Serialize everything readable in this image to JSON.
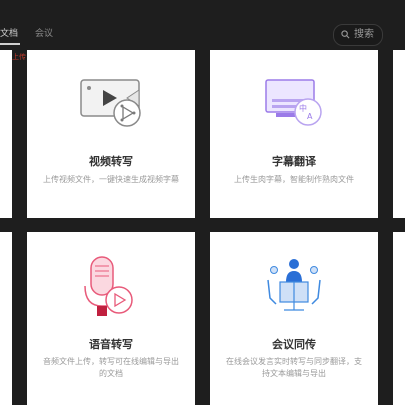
{
  "header": {
    "tabs": [
      {
        "label": "文档",
        "active": true
      },
      {
        "label": "会议",
        "active": false
      }
    ],
    "red_mark": "上传",
    "search_label": "搜索"
  },
  "cards": [
    {
      "title": "视频转写",
      "desc": "上传视频文件，一键快速生成视频字幕",
      "icon": "video-transcribe-icon",
      "accent": "#7a7a7a"
    },
    {
      "title": "字幕翻译",
      "desc": "上传生肉字幕，智能制作熟肉文件",
      "icon": "subtitle-translate-icon",
      "accent": "#9b7be8"
    },
    {
      "title": "语音转写",
      "desc": "音频文件上传，转写可在线编辑与导出的文档",
      "icon": "voice-transcribe-icon",
      "accent": "#e85a7a"
    },
    {
      "title": "会议同传",
      "desc": "在线会议发言实时转写与同步翻译，支持文本编辑与导出",
      "icon": "meeting-interpret-icon",
      "accent": "#3f8ae0"
    }
  ]
}
